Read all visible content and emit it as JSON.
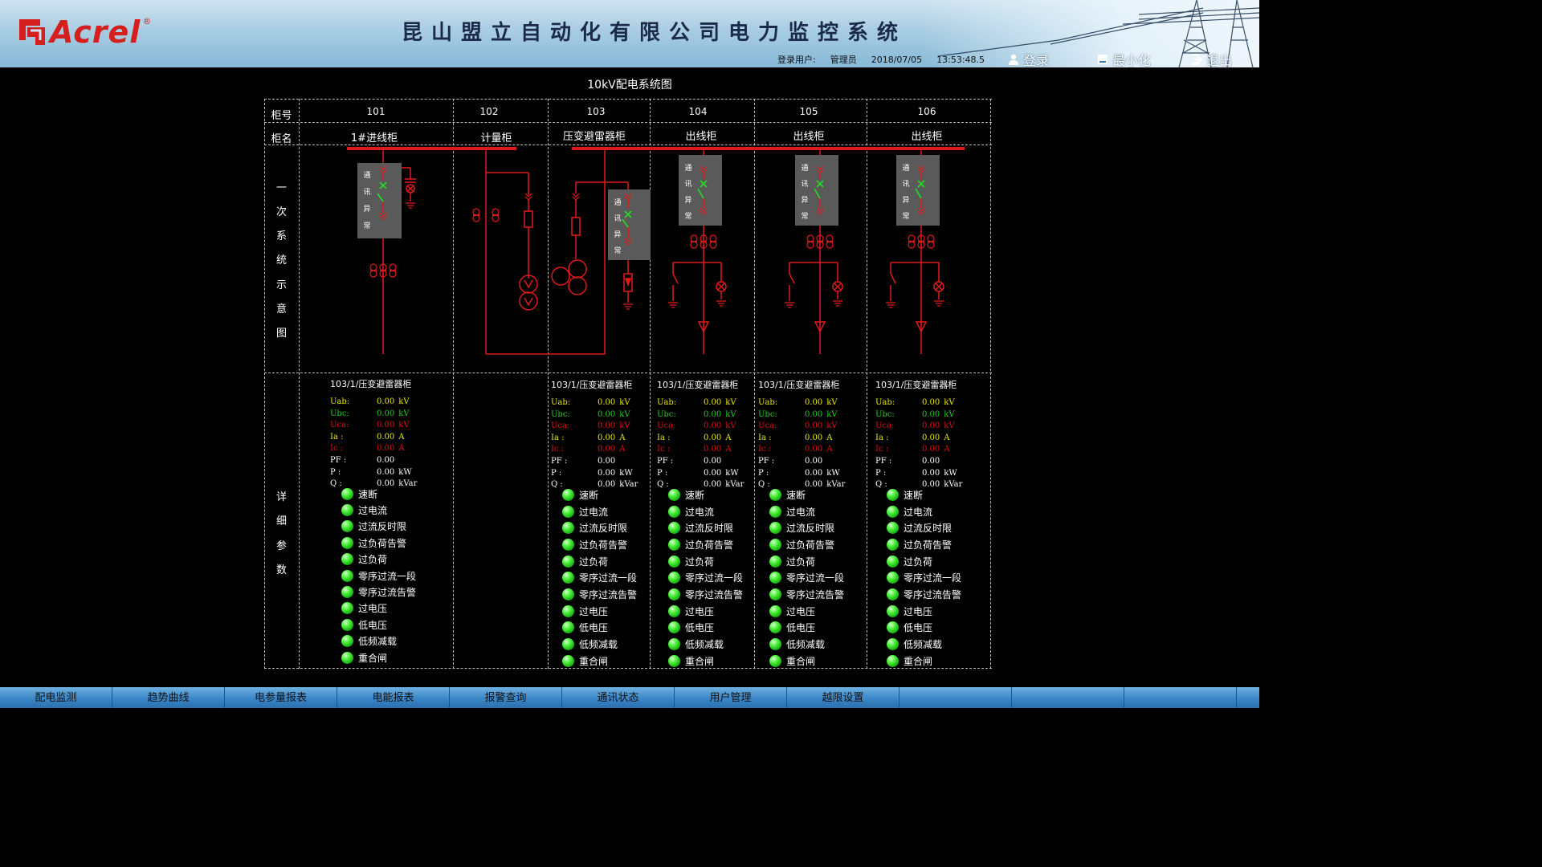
{
  "header": {
    "logo_text": "Acrel",
    "logo_reg": "®",
    "title": "昆山盟立自动化有限公司电力监控系统",
    "status": {
      "user_label": "登录用户:",
      "user": "管理员",
      "date": "2018/07/05",
      "time": "13:53:48.5"
    },
    "buttons": {
      "login": "登录",
      "minimize": "最小化",
      "exit": "退出"
    }
  },
  "page_title": "10kV配电系统图",
  "table": {
    "row_labels": {
      "cabinet_no": "柜号",
      "cabinet_name": "柜名",
      "diagram": "一次系统示意图",
      "details": "详细参数"
    },
    "cabinets": [
      {
        "no": "101",
        "name": "1#进线柜",
        "status": "通讯异常"
      },
      {
        "no": "102",
        "name": "计量柜"
      },
      {
        "no": "103",
        "name": "压变避雷器柜",
        "status": "通讯异常"
      },
      {
        "no": "104",
        "name": "出线柜",
        "status": "通讯异常"
      },
      {
        "no": "105",
        "name": "出线柜",
        "status": "通讯异常"
      },
      {
        "no": "106",
        "name": "出线柜",
        "status": "通讯异常"
      }
    ]
  },
  "detail_caption": "103/1/压变避雷器柜",
  "measurements": [
    {
      "label": "Uab:",
      "value": "0.00",
      "unit": "kV",
      "color": "#e8e800"
    },
    {
      "label": "Ubc:",
      "value": "0.00",
      "unit": "kV",
      "color": "#22cc22"
    },
    {
      "label": "Uca:",
      "value": "0.00",
      "unit": "kV",
      "color": "#e01010"
    },
    {
      "label": "Ia :",
      "value": "0.00",
      "unit": "A",
      "color": "#e8e800"
    },
    {
      "label": "Ic :",
      "value": "0.00",
      "unit": "A",
      "color": "#e01010"
    },
    {
      "label": "PF :",
      "value": "0.00",
      "unit": "",
      "color": "#ffffff"
    },
    {
      "label": "P  :",
      "value": "0.00",
      "unit": "kW",
      "color": "#ffffff"
    },
    {
      "label": "Q  :",
      "value": "0.00",
      "unit": "kVar",
      "color": "#ffffff"
    }
  ],
  "alarms": [
    "速断",
    "过电流",
    "过流反时限",
    "过负荷告警",
    "过负荷",
    "零序过流一段",
    "零序过流告警",
    "过电压",
    "低电压",
    "低频减载",
    "重合闸"
  ],
  "colors": {
    "busbar": "#e01a1a",
    "breaker_closed": "#22dd22",
    "led_on": "#2ee81f"
  },
  "nav": [
    "配电监测",
    "趋势曲线",
    "电参量报表",
    "电能报表",
    "报警查询",
    "通讯状态",
    "用户管理",
    "越限设置"
  ]
}
